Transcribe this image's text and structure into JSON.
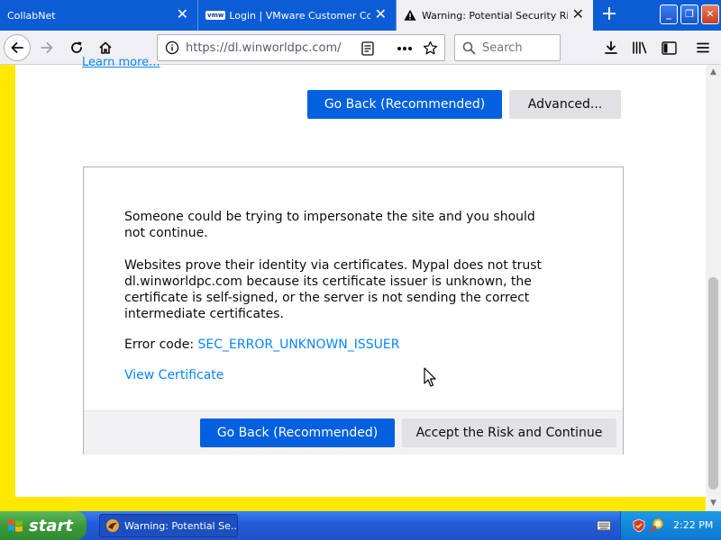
{
  "tabs": [
    {
      "title": "CollabNet",
      "active": false
    },
    {
      "title": "Login | VMware Customer Connect",
      "active": false
    },
    {
      "title": "Warning: Potential Security Risk Ahead",
      "active": true
    }
  ],
  "tab_close_glyph": "✕",
  "new_tab_glyph": "+",
  "window_buttons": {
    "minimize": "_",
    "maximize": "❐",
    "close": "✕"
  },
  "vmware_badge": "vmw",
  "navbar": {
    "url": "https://dl.winworldpc.com/",
    "search_placeholder": "Search"
  },
  "page": {
    "learn_more": "Learn more...",
    "top_buttons": {
      "go_back": "Go Back (Recommended)",
      "advanced": "Advanced..."
    },
    "paragraph1": "Someone could be trying to impersonate the site and you should not continue.",
    "paragraph2": "Websites prove their identity via certificates. Mypal does not trust dl.winworldpc.com because its certificate issuer is unknown, the certificate is self-signed, or the server is not sending the correct intermediate certificates.",
    "error_code_label": "Error code:",
    "error_code": "SEC_ERROR_UNKNOWN_ISSUER",
    "view_certificate": "View Certificate",
    "footer_buttons": {
      "go_back": "Go Back (Recommended)",
      "accept": "Accept the Risk and Continue"
    }
  },
  "taskbar": {
    "start_label": "start",
    "task_item": "Warning: Potential Se...",
    "clock": "2:22 PM"
  },
  "colors": {
    "tab_strip": "#0c5cd6",
    "warning_border": "#ffe900",
    "primary_button": "#0060df",
    "link": "#0a84ff"
  }
}
